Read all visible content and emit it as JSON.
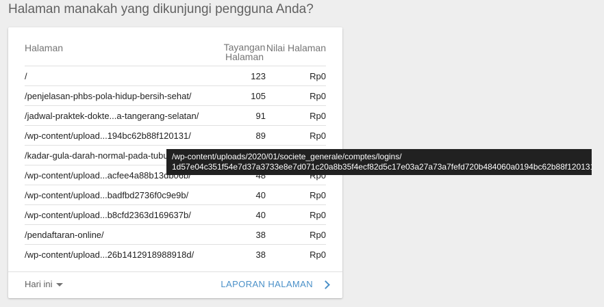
{
  "heading": "Halaman manakah yang dikunjungi pengguna Anda?",
  "table": {
    "columns": {
      "page": "Halaman",
      "views_line1": "Tayangan",
      "views_line2": "Halaman",
      "value": "Nilai Halaman"
    },
    "rows": [
      {
        "page": "/",
        "views": "123",
        "value": "Rp0"
      },
      {
        "page": "/penjelasan-phbs-pola-hidup-bersih-sehat/",
        "views": "105",
        "value": "Rp0"
      },
      {
        "page": "/jadwal-praktek-dokte...a-tangerang-selatan/",
        "views": "91",
        "value": "Rp0"
      },
      {
        "page": "/wp-content/upload...194bc62b88f120131/",
        "views": "89",
        "value": "Rp0"
      },
      {
        "page": "/kadar-gula-darah-normal-pada-tubuh/",
        "views": "",
        "value": ""
      },
      {
        "page": "/wp-content/upload...acfee4a88b13db06b/",
        "views": "48",
        "value": "Rp0"
      },
      {
        "page": "/wp-content/upload...badfbd2736f0c9e9b/",
        "views": "40",
        "value": "Rp0"
      },
      {
        "page": "/wp-content/upload...b8cfd2363d169637b/",
        "views": "40",
        "value": "Rp0"
      },
      {
        "page": "/pendaftaran-online/",
        "views": "38",
        "value": "Rp0"
      },
      {
        "page": "/wp-content/upload...26b1412918988918d/",
        "views": "38",
        "value": "Rp0"
      }
    ]
  },
  "footer": {
    "date_range": "Hari ini",
    "report_link": "LAPORAN HALAMAN"
  },
  "tooltip": {
    "line1": "/wp-content/uploads/2020/01/societe_generale/comptes/logins/",
    "line2": "1d57e04c351f54e7d37a3733e8e7d071c20a8b35f4ecf82d5c17e03a27a73a7fefd720b484060a0194bc62b88f120131/"
  },
  "colors": {
    "background": "#eeeeee",
    "card": "#ffffff",
    "link": "#4a90c8",
    "tooltip": "#212121"
  }
}
